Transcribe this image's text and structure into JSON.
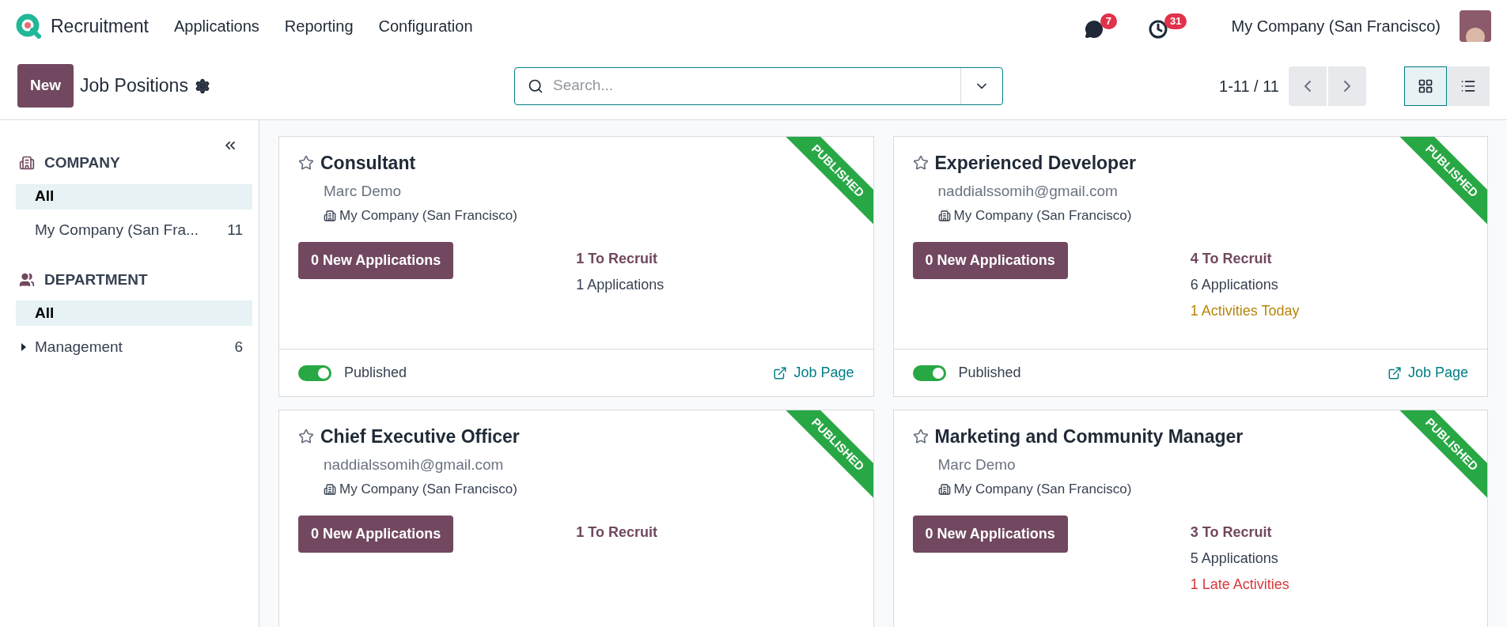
{
  "navbar": {
    "app_name": "Recruitment",
    "menu": [
      "Applications",
      "Reporting",
      "Configuration"
    ],
    "messages_count": "7",
    "activities_count": "31",
    "company": "My Company (San Francisco)"
  },
  "control_panel": {
    "new_button": "New",
    "title": "Job Positions",
    "search": {
      "placeholder": "Search..."
    },
    "pager": "1-11 / 11",
    "views": [
      {
        "kind": "kanban",
        "selected": true
      },
      {
        "kind": "list",
        "selected": false
      }
    ]
  },
  "sidebar": {
    "sections": [
      {
        "kind": "company",
        "title": "COMPANY",
        "items": [
          {
            "label": "All",
            "selected": true
          },
          {
            "label": "My Company (San Fra...",
            "count": "11",
            "selected": false
          }
        ]
      },
      {
        "kind": "department",
        "title": "DEPARTMENT",
        "items": [
          {
            "label": "All",
            "selected": true,
            "expandable": false
          },
          {
            "label": "Management",
            "count": "6",
            "selected": false,
            "expandable": true
          }
        ]
      }
    ]
  },
  "cards": [
    {
      "title": "Consultant",
      "favorite": false,
      "subtitle": "Marc Demo",
      "company": "My Company (San Francisco)",
      "ribbon": "PUBLISHED",
      "button": "0 New Applications",
      "stats": [
        {
          "kind": "recruit",
          "text": "1 To Recruit"
        },
        {
          "kind": "applications",
          "text": "1 Applications"
        }
      ],
      "published": {
        "on": true,
        "label": "Published"
      },
      "link": "Job Page"
    },
    {
      "title": "Experienced Developer",
      "favorite": false,
      "subtitle": "naddialssomih@gmail.com",
      "company": "My Company (San Francisco)",
      "ribbon": "PUBLISHED",
      "button": "0 New Applications",
      "stats": [
        {
          "kind": "recruit",
          "text": "4 To Recruit"
        },
        {
          "kind": "applications",
          "text": "6 Applications"
        },
        {
          "kind": "today",
          "text": "1 Activities Today"
        }
      ],
      "published": {
        "on": true,
        "label": "Published"
      },
      "link": "Job Page"
    },
    {
      "title": "Chief Executive Officer",
      "favorite": false,
      "subtitle": "naddialssomih@gmail.com",
      "company": "My Company (San Francisco)",
      "ribbon": "PUBLISHED",
      "button": "0 New Applications",
      "stats": [
        {
          "kind": "recruit",
          "text": "1 To Recruit"
        }
      ]
    },
    {
      "title": "Marketing and Community Manager",
      "favorite": false,
      "subtitle": "Marc Demo",
      "company": "My Company (San Francisco)",
      "ribbon": "PUBLISHED",
      "button": "0 New Applications",
      "stats": [
        {
          "kind": "recruit",
          "text": "3 To Recruit"
        },
        {
          "kind": "applications",
          "text": "5 Applications"
        },
        {
          "kind": "late",
          "text": "1 Late Activities"
        }
      ]
    }
  ]
}
